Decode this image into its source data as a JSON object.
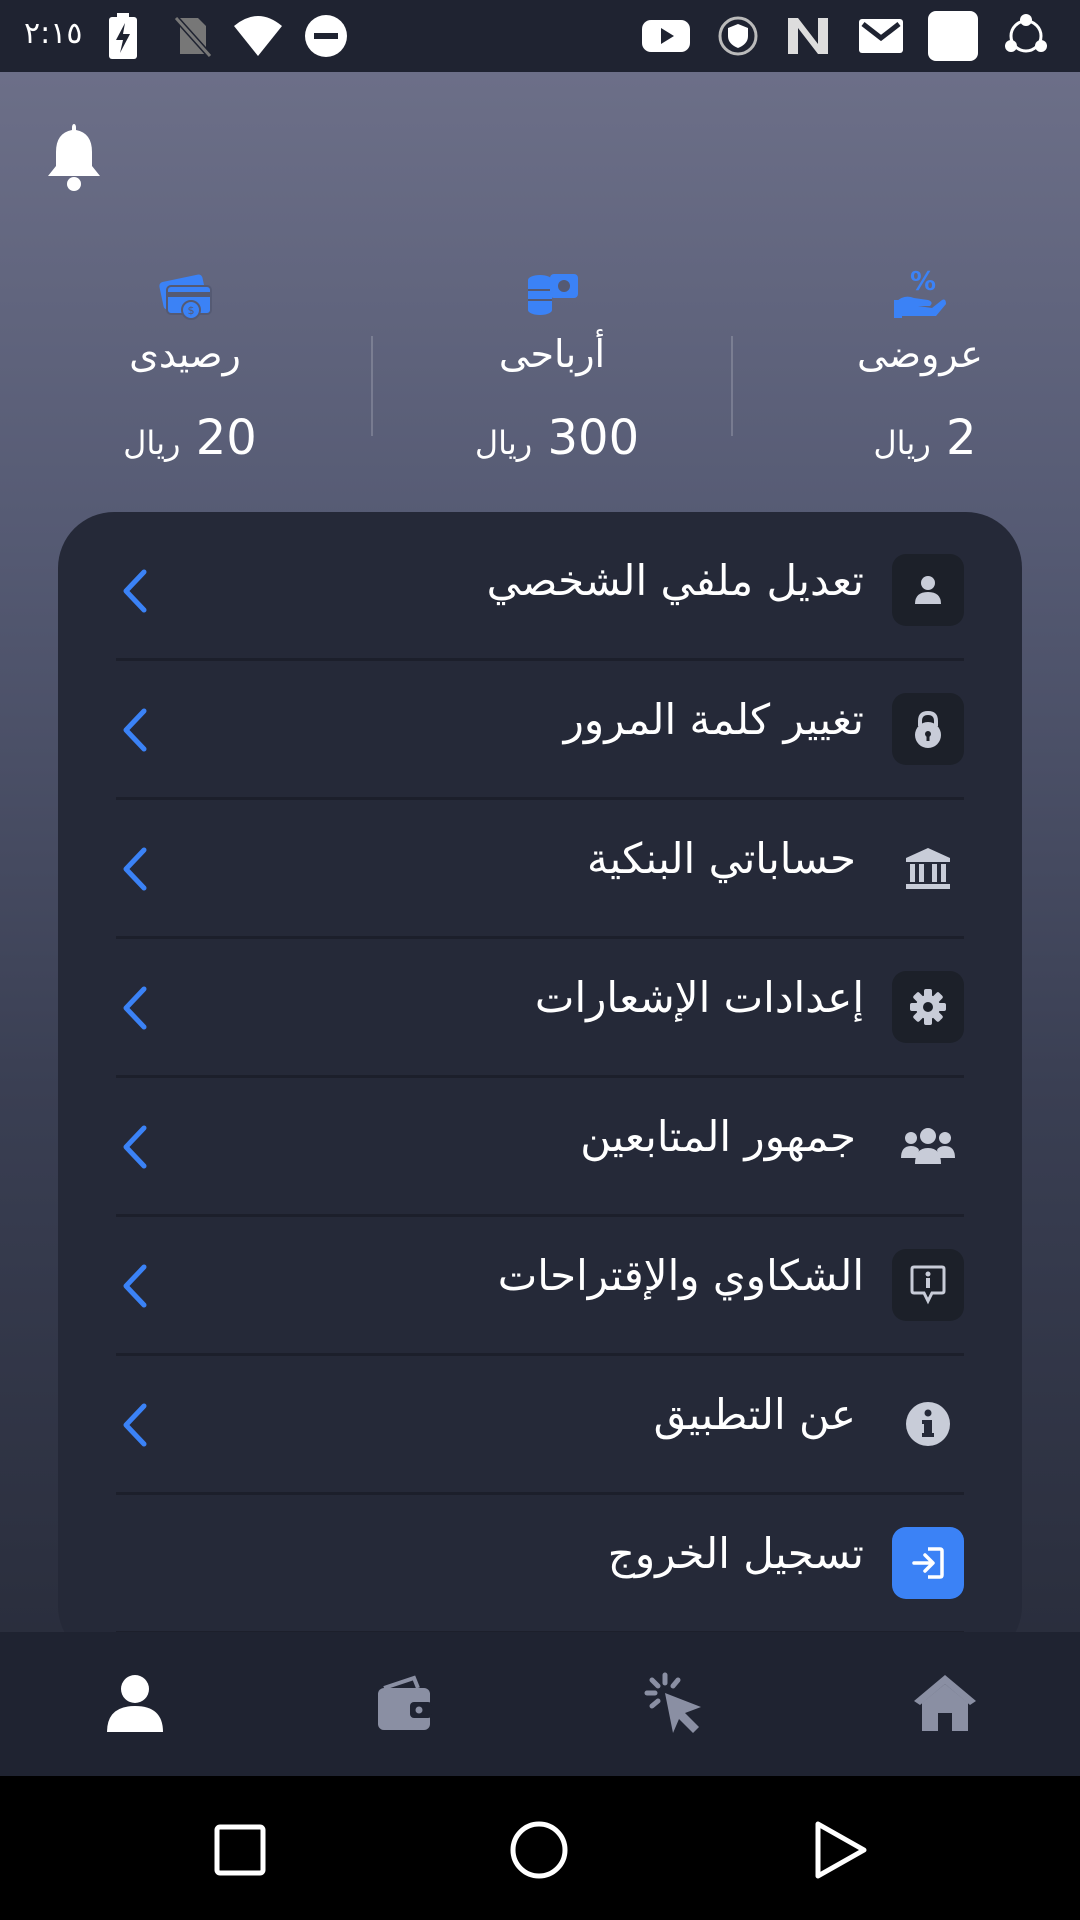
{
  "status_bar": {
    "time": "٢:١٥",
    "icons": [
      "battery-charging-icon",
      "no-sim-icon",
      "wifi-icon",
      "do-not-disturb-icon",
      "youtube-icon",
      "shield-icon",
      "n-app-icon",
      "gmail-icon",
      "white-square-icon",
      "sync-icon"
    ]
  },
  "header": {
    "bell_icon": "bell-icon"
  },
  "stats": [
    {
      "label": "رصيدى",
      "value": "20",
      "currency": "ريال",
      "icon": "card-money-icon"
    },
    {
      "label": "أرباحى",
      "value": "300",
      "currency": "ريال",
      "icon": "coins-icon"
    },
    {
      "label": "عروضى",
      "value": "2",
      "currency": "ريال",
      "icon": "hand-percent-icon"
    }
  ],
  "menu": [
    {
      "label": "تعديل ملفي الشخصي",
      "icon": "user-icon"
    },
    {
      "label": "تغيير كلمة المرور",
      "icon": "lock-icon"
    },
    {
      "label": "حساباتي البنكية",
      "icon": "bank-icon"
    },
    {
      "label": "إعدادات الإشعارات",
      "icon": "gear-icon"
    },
    {
      "label": "جمهور المتابعين",
      "icon": "users-icon"
    },
    {
      "label": "الشكاوي والإقتراحات",
      "icon": "info-bubble-icon"
    },
    {
      "label": "عن التطبيق",
      "icon": "info-circle-icon"
    },
    {
      "label": "تسجيل الخروج",
      "icon": "logout-icon"
    }
  ],
  "bottom_nav": [
    "profile-icon",
    "wallet-icon",
    "click-icon",
    "home-icon"
  ],
  "colors": {
    "accent": "#3b82f6",
    "card": "#252938",
    "bar": "#1f2331"
  }
}
